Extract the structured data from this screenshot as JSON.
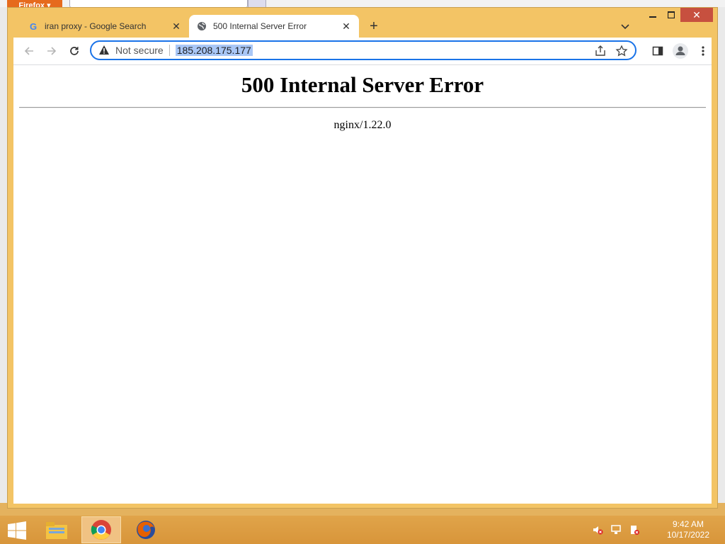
{
  "background_window": {
    "app_button_label": "Firefox ▾"
  },
  "tabs": [
    {
      "title": "iran proxy - Google Search",
      "icon": "google-icon",
      "active": false
    },
    {
      "title": "500 Internal Server Error",
      "icon": "globe-icon",
      "active": true
    }
  ],
  "toolbar": {
    "security_label": "Not secure",
    "url": "185.208.175.177"
  },
  "page": {
    "heading": "500 Internal Server Error",
    "server": "nginx/1.22.0"
  },
  "taskbar": {
    "time": "9:42 AM",
    "date": "10/17/2022",
    "items": [
      "file-explorer-icon",
      "chrome-icon",
      "firefox-icon"
    ]
  },
  "colors": {
    "frame": "#f3c465",
    "accent": "#1a73e8",
    "url_highlight": "#a9c7f6",
    "close_button": "#c7503f"
  }
}
